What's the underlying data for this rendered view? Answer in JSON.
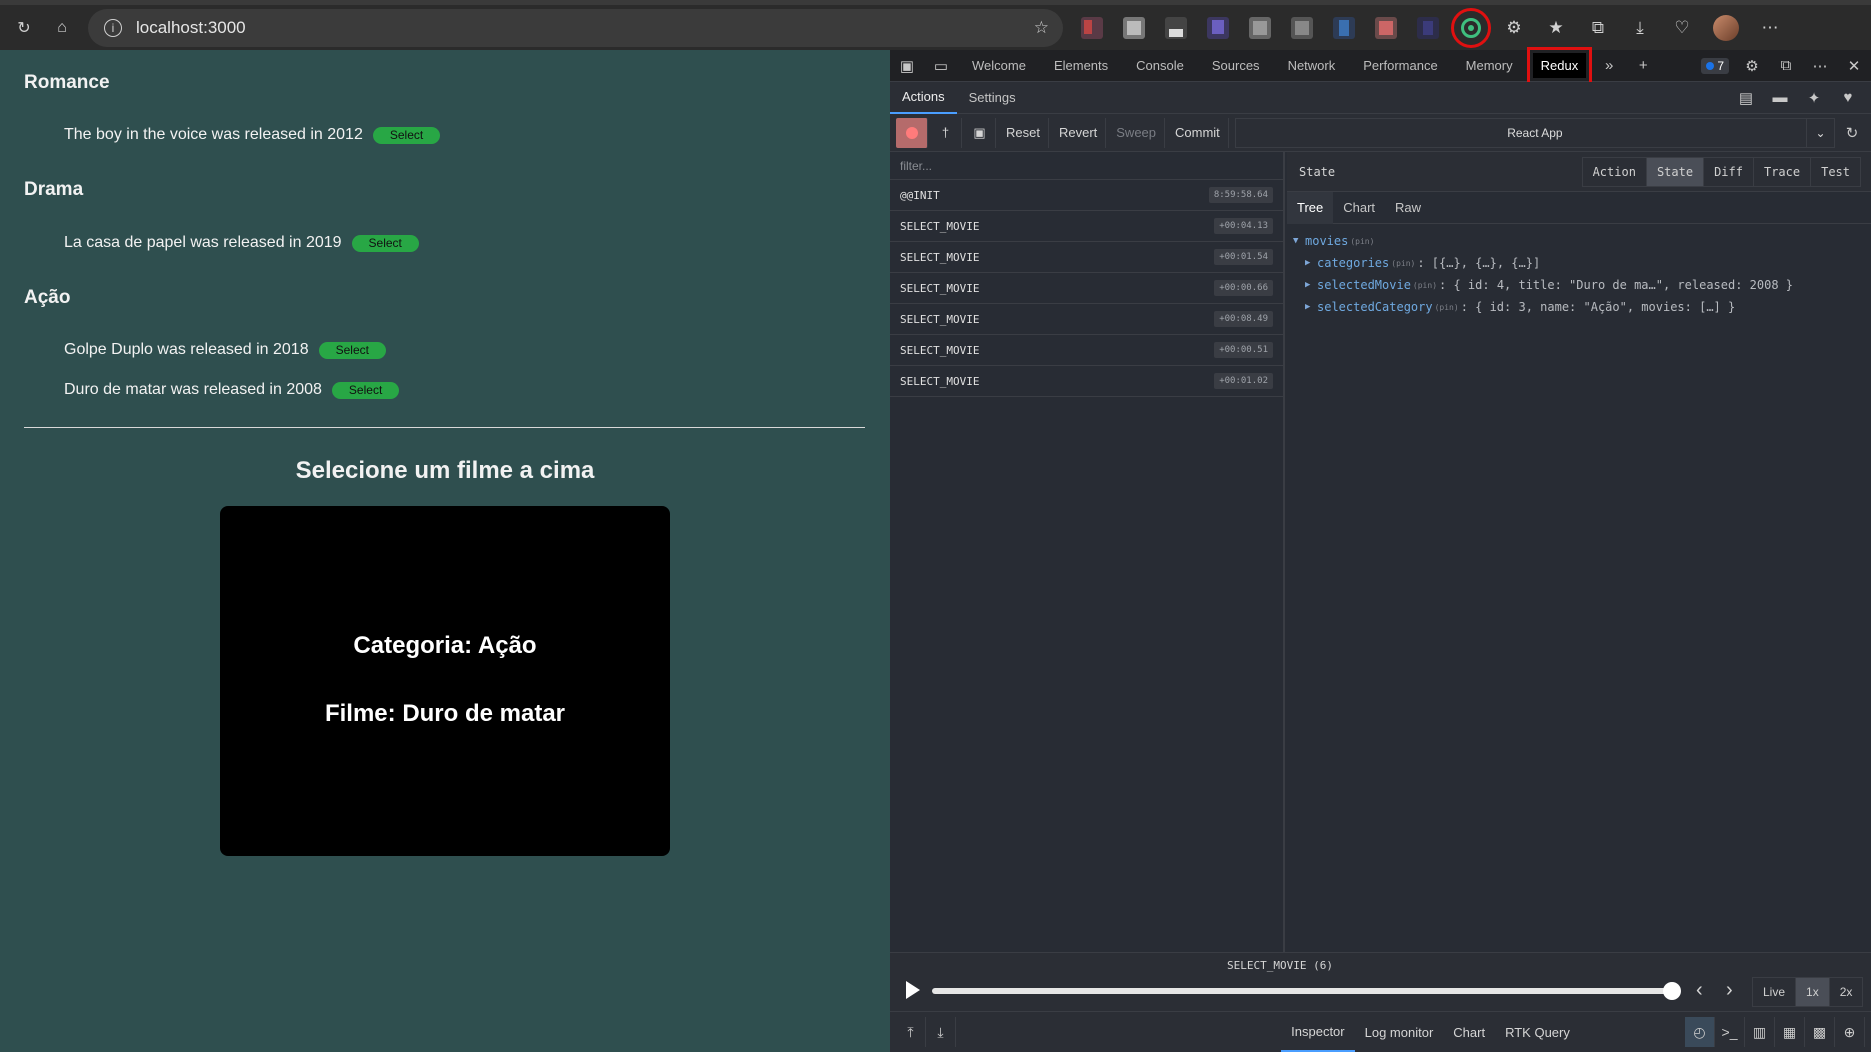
{
  "browser": {
    "url": "localhost:3000"
  },
  "app": {
    "categories": [
      {
        "name": "Romance",
        "movies": [
          {
            "text": "The boy in the voice was released in 2012"
          }
        ]
      },
      {
        "name": "Drama",
        "movies": [
          {
            "text": "La casa de papel was released in 2019"
          }
        ]
      },
      {
        "name": "Ação",
        "movies": [
          {
            "text": "Golpe Duplo was released in 2018"
          },
          {
            "text": "Duro de matar was released in 2008"
          }
        ]
      }
    ],
    "select_label": "Select",
    "selection_title": "Selecione um filme a cima",
    "card": {
      "category_line": "Categoria: Ação",
      "movie_line": "Filme: Duro de matar"
    }
  },
  "devtools": {
    "tabs": [
      "Welcome",
      "Elements",
      "Console",
      "Sources",
      "Network",
      "Performance",
      "Memory"
    ],
    "active_tab": "Redux",
    "issues_count": "7",
    "sub_tabs": [
      "Actions",
      "Settings"
    ],
    "toolbar": {
      "reset": "Reset",
      "revert": "Revert",
      "sweep": "Sweep",
      "commit": "Commit",
      "instance": "React App"
    },
    "filter_placeholder": "filter...",
    "actions": [
      {
        "type": "@@INIT",
        "time": "8:59:58.64"
      },
      {
        "type": "SELECT_MOVIE",
        "time": "+00:04.13"
      },
      {
        "type": "SELECT_MOVIE",
        "time": "+00:01.54"
      },
      {
        "type": "SELECT_MOVIE",
        "time": "+00:00.66"
      },
      {
        "type": "SELECT_MOVIE",
        "time": "+00:08.49"
      },
      {
        "type": "SELECT_MOVIE",
        "time": "+00:00.51"
      },
      {
        "type": "SELECT_MOVIE",
        "time": "+00:01.02"
      }
    ],
    "state_pane": {
      "title": "State",
      "modes": [
        "Action",
        "State",
        "Diff",
        "Trace",
        "Test"
      ],
      "active_mode": "State",
      "views": [
        "Tree",
        "Chart",
        "Raw"
      ],
      "active_view": "Tree",
      "pin_label": "(pin)",
      "tree": {
        "root": "movies",
        "children": [
          {
            "key": "categories",
            "value": ": [{…}, {…}, {…}]"
          },
          {
            "key": "selectedMovie",
            "value": ": { id: 4, title: \"Duro de ma…\", released: 2008 }"
          },
          {
            "key": "selectedCategory",
            "value": ": { id: 3, name: \"Ação\", movies: […] }"
          }
        ]
      }
    },
    "slider": {
      "label": "SELECT_MOVIE (6)",
      "speeds": [
        "Live",
        "1x",
        "2x"
      ],
      "active_speed": "1x"
    },
    "monitors": [
      "Inspector",
      "Log monitor",
      "Chart",
      "RTK Query"
    ],
    "active_monitor": "Inspector"
  },
  "colors": {
    "app_bg": "#2f4f4f",
    "select_green": "#28a745",
    "highlight_red": "#e01010",
    "devtools_bg": "#282c34"
  }
}
